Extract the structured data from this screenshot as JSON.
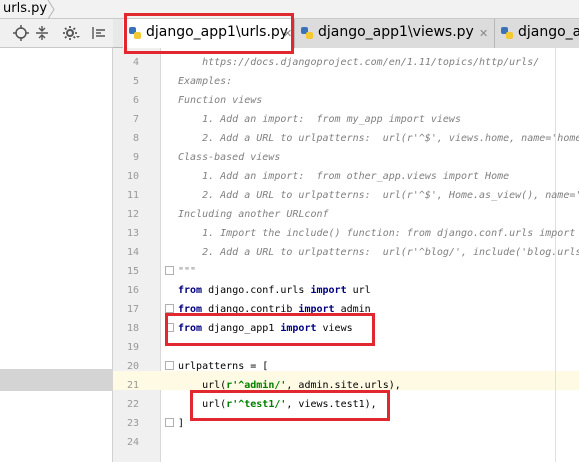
{
  "breadcrumb": {
    "file": "urls.py"
  },
  "tabs": [
    {
      "label": "django_app1\\urls.py",
      "active": true
    },
    {
      "label": "django_app1\\views.py",
      "active": false
    },
    {
      "label": "django_ap",
      "active": false
    }
  ],
  "editor": {
    "lines": [
      {
        "num": "4",
        "text": "    https://docs.djangoproject.com/en/1.11/topics/http/urls/"
      },
      {
        "num": "5",
        "text": "Examples:"
      },
      {
        "num": "6",
        "text": "Function views"
      },
      {
        "num": "7",
        "text": "    1. Add an import:  from my_app import views"
      },
      {
        "num": "8",
        "text": "    2. Add a URL to urlpatterns:  url(r'^$', views.home, name='home"
      },
      {
        "num": "9",
        "text": "Class-based views"
      },
      {
        "num": "10",
        "text": "    1. Add an import:  from other_app.views import Home"
      },
      {
        "num": "11",
        "text": "    2. Add a URL to urlpatterns:  url(r'^$', Home.as_view(), name='"
      },
      {
        "num": "12",
        "text": "Including another URLconf"
      },
      {
        "num": "13",
        "text": "    1. Import the include() function: from django.conf.urls import"
      },
      {
        "num": "14",
        "text": "    2. Add a URL to urlpatterns:  url(r'^blog/', include('blog.urls"
      },
      {
        "num": "15",
        "text": "\"\"\""
      },
      {
        "num": "16",
        "kw1": "from",
        "mid": " django.conf.urls ",
        "kw2": "import",
        "rest": " url"
      },
      {
        "num": "17",
        "kw1": "from",
        "mid": " django.contrib ",
        "kw2": "import",
        "rest": " admin"
      },
      {
        "num": "18",
        "kw1": "from",
        "mid": " django_app1 ",
        "kw2": "import",
        "rest": " views"
      },
      {
        "num": "19",
        "text": ""
      },
      {
        "num": "20",
        "text": "urlpatterns = ["
      },
      {
        "num": "21",
        "pre": "    url(",
        "str": "r'^admin/'",
        "post": ", admin.site.urls),"
      },
      {
        "num": "22",
        "pre": "    url(",
        "str": "r'^test1/'",
        "post": ", views.test1),"
      },
      {
        "num": "23",
        "text": "]"
      },
      {
        "num": "24",
        "text": ""
      }
    ]
  },
  "colors": {
    "annotation": "#e0282e",
    "keyword": "#000080",
    "string": "#008000",
    "docstring": "#808080"
  }
}
